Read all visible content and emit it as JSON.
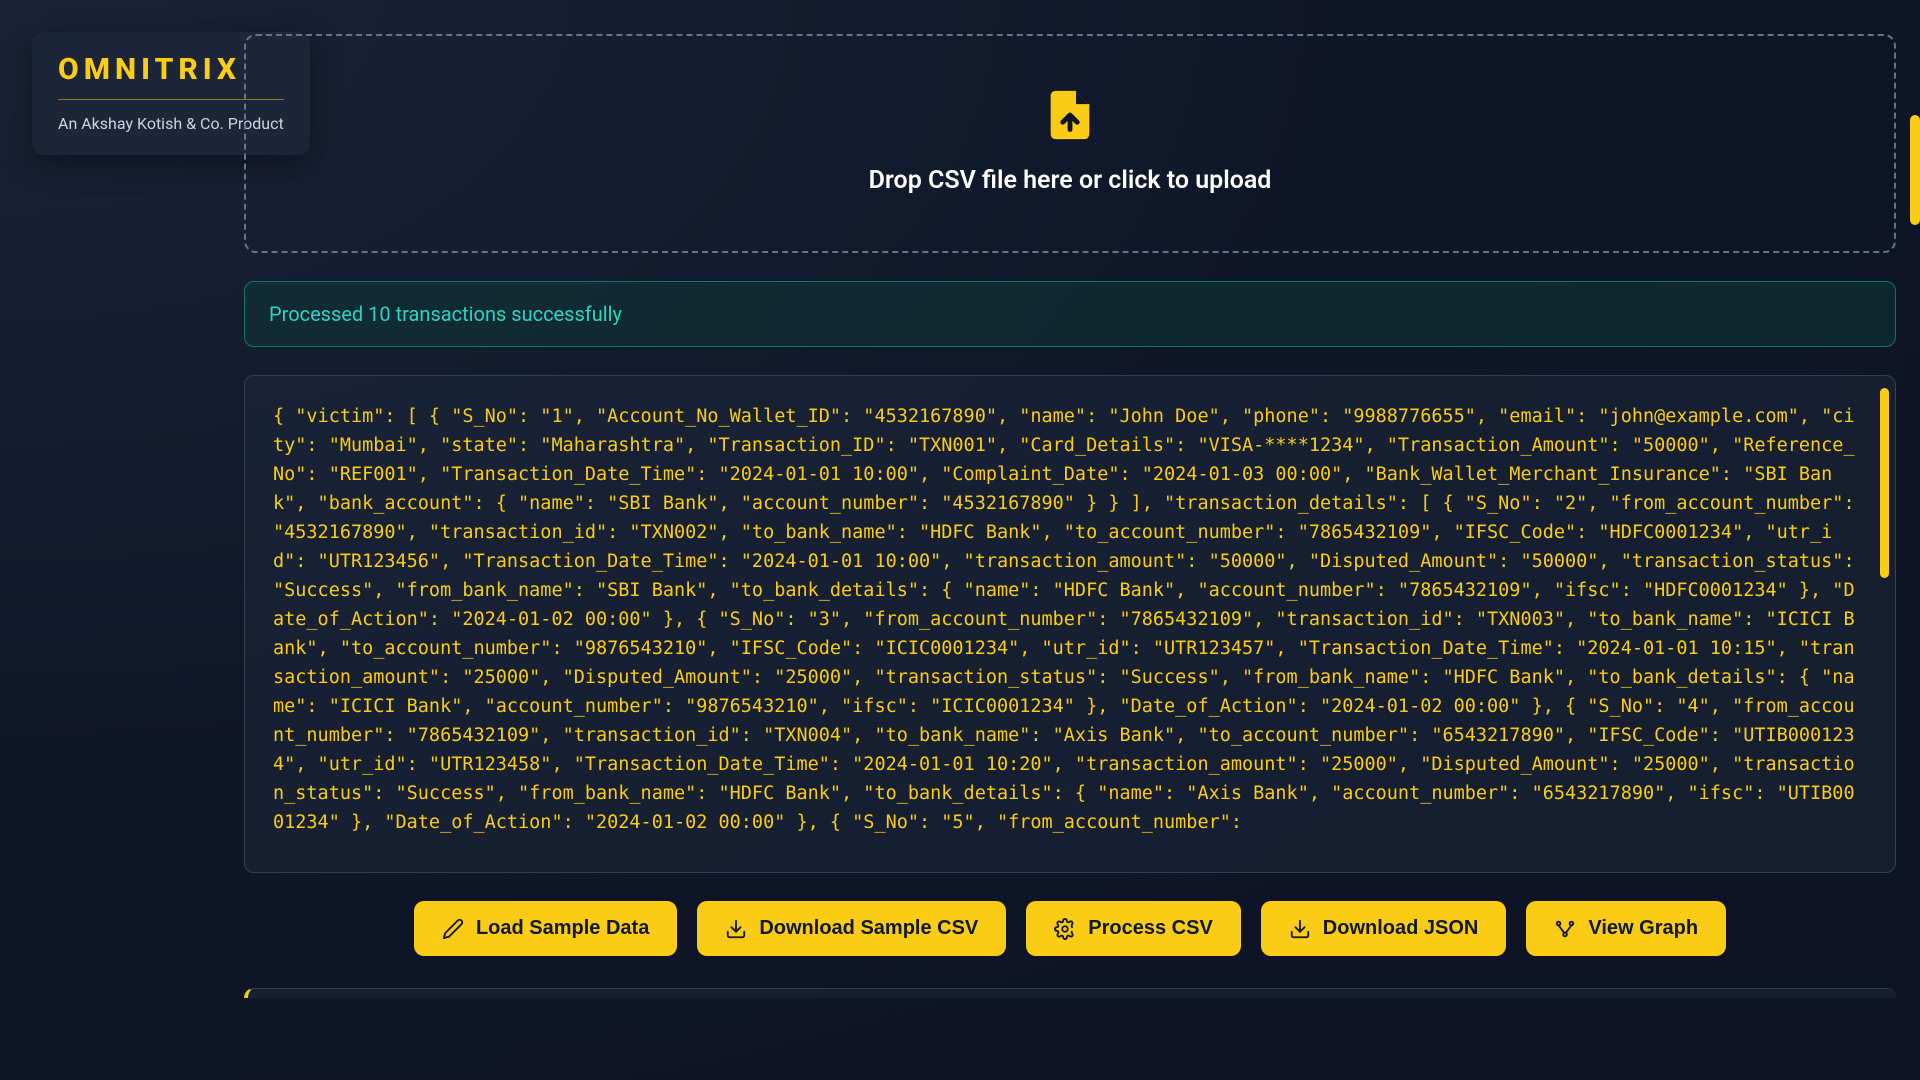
{
  "brand": {
    "title": "OMNITRIX",
    "subtitle": "An Akshay Kotish & Co. Product"
  },
  "dropzone": {
    "text": "Drop CSV file here or click to upload"
  },
  "status": {
    "message": "Processed 10 transactions successfully"
  },
  "json_output": "{ \"victim\": [ { \"S_No\": \"1\", \"Account_No_Wallet_ID\": \"4532167890\", \"name\": \"John Doe\", \"phone\": \"9988776655\", \"email\": \"john@example.com\", \"city\": \"Mumbai\", \"state\": \"Maharashtra\", \"Transaction_ID\": \"TXN001\", \"Card_Details\": \"VISA-****1234\", \"Transaction_Amount\": \"50000\", \"Reference_No\": \"REF001\", \"Transaction_Date_Time\": \"2024-01-01 10:00\", \"Complaint_Date\": \"2024-01-03 00:00\", \"Bank_Wallet_Merchant_Insurance\": \"SBI Bank\", \"bank_account\": { \"name\": \"SBI Bank\", \"account_number\": \"4532167890\" } } ], \"transaction_details\": [ { \"S_No\": \"2\", \"from_account_number\": \"4532167890\", \"transaction_id\": \"TXN002\", \"to_bank_name\": \"HDFC Bank\", \"to_account_number\": \"7865432109\", \"IFSC_Code\": \"HDFC0001234\", \"utr_id\": \"UTR123456\", \"Transaction_Date_Time\": \"2024-01-01 10:00\", \"transaction_amount\": \"50000\", \"Disputed_Amount\": \"50000\", \"transaction_status\": \"Success\", \"from_bank_name\": \"SBI Bank\", \"to_bank_details\": { \"name\": \"HDFC Bank\", \"account_number\": \"7865432109\", \"ifsc\": \"HDFC0001234\" }, \"Date_of_Action\": \"2024-01-02 00:00\" }, { \"S_No\": \"3\", \"from_account_number\": \"7865432109\", \"transaction_id\": \"TXN003\", \"to_bank_name\": \"ICICI Bank\", \"to_account_number\": \"9876543210\", \"IFSC_Code\": \"ICIC0001234\", \"utr_id\": \"UTR123457\", \"Transaction_Date_Time\": \"2024-01-01 10:15\", \"transaction_amount\": \"25000\", \"Disputed_Amount\": \"25000\", \"transaction_status\": \"Success\", \"from_bank_name\": \"HDFC Bank\", \"to_bank_details\": { \"name\": \"ICICI Bank\", \"account_number\": \"9876543210\", \"ifsc\": \"ICIC0001234\" }, \"Date_of_Action\": \"2024-01-02 00:00\" }, { \"S_No\": \"4\", \"from_account_number\": \"7865432109\", \"transaction_id\": \"TXN004\", \"to_bank_name\": \"Axis Bank\", \"to_account_number\": \"6543217890\", \"IFSC_Code\": \"UTIB0001234\", \"utr_id\": \"UTR123458\", \"Transaction_Date_Time\": \"2024-01-01 10:20\", \"transaction_amount\": \"25000\", \"Disputed_Amount\": \"25000\", \"transaction_status\": \"Success\", \"from_bank_name\": \"HDFC Bank\", \"to_bank_details\": { \"name\": \"Axis Bank\", \"account_number\": \"6543217890\", \"ifsc\": \"UTIB0001234\" }, \"Date_of_Action\": \"2024-01-02 00:00\" }, { \"S_No\": \"5\", \"from_account_number\":",
  "buttons": {
    "load_sample": "Load Sample Data",
    "download_csv": "Download Sample CSV",
    "process_csv": "Process CSV",
    "download_json": "Download JSON",
    "view_graph": "View Graph"
  }
}
